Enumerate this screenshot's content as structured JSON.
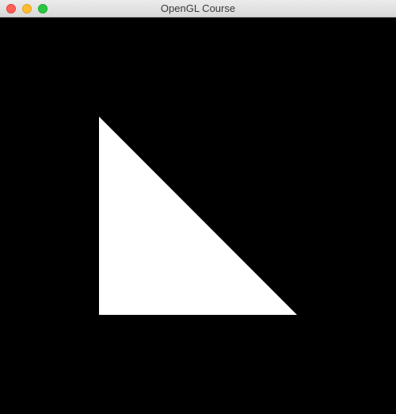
{
  "window": {
    "title": "OpenGL Course"
  },
  "colors": {
    "close": "#fe5f57",
    "close_border": "#e0443e",
    "minimize": "#febc2e",
    "minimize_border": "#dea123",
    "zoom": "#28c840",
    "zoom_border": "#1aab29",
    "clear_color": "#000000",
    "triangle_fill": "#ffffff"
  },
  "scene": {
    "shape": "triangle",
    "vertices_ndc": [
      [
        -0.5,
        0.5
      ],
      [
        -0.5,
        -0.5
      ],
      [
        0.5,
        -0.5
      ]
    ]
  }
}
